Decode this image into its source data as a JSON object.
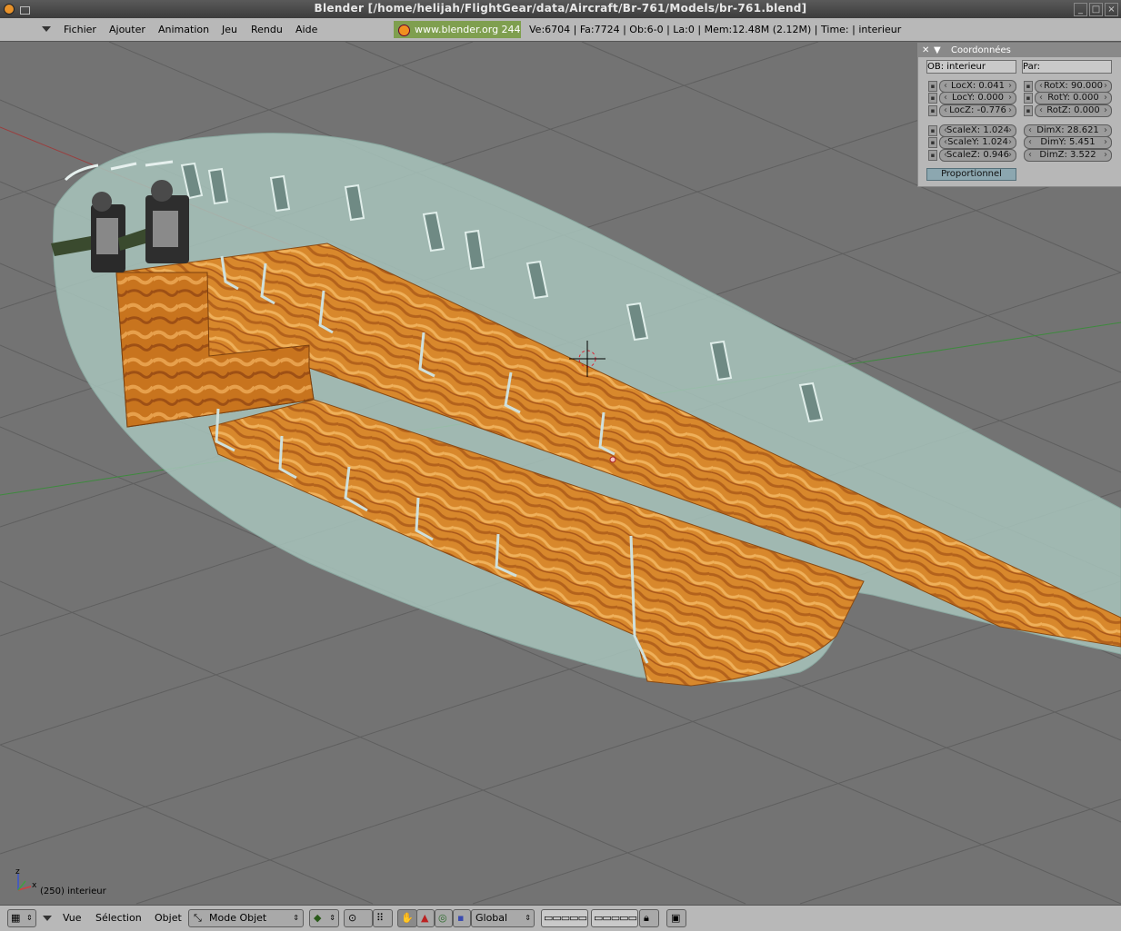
{
  "window": {
    "title": "Blender [/home/helijah/FlightGear/data/Aircraft/Br-761/Models/br-761.blend]",
    "controls": [
      "_",
      "□",
      "×"
    ]
  },
  "header": {
    "menus": [
      "Fichier",
      "Ajouter",
      "Animation",
      "Jeu",
      "Rendu",
      "Aide"
    ],
    "link": "www.blender.org 244",
    "stats": "Ve:6704 | Fa:7724 | Ob:6-0 | La:0  | Mem:12.48M (2.12M)  | Time: | interieur"
  },
  "panel": {
    "title": "Coordonnées",
    "ob": "OB: interieur",
    "par": "Par:",
    "loc": [
      "LocX: 0.041",
      "LocY: 0.000",
      "LocZ: -0.776"
    ],
    "rot": [
      "RotX: 90.000",
      "RotY: 0.000",
      "RotZ: 0.000"
    ],
    "scale": [
      "ScaleX: 1.024",
      "ScaleY: 1.024",
      "ScaleZ: 0.946"
    ],
    "dim": [
      "DimX: 28.621",
      "DimY: 5.451",
      "DimZ: 3.522"
    ],
    "proportional": "Proportionnel"
  },
  "viewport": {
    "object_label": "(250) interieur",
    "axis_z": "z",
    "axis_x": "x"
  },
  "footer": {
    "menus": [
      "Vue",
      "Sélection",
      "Objet"
    ],
    "mode": "Mode Objet",
    "orientation": "Global"
  }
}
